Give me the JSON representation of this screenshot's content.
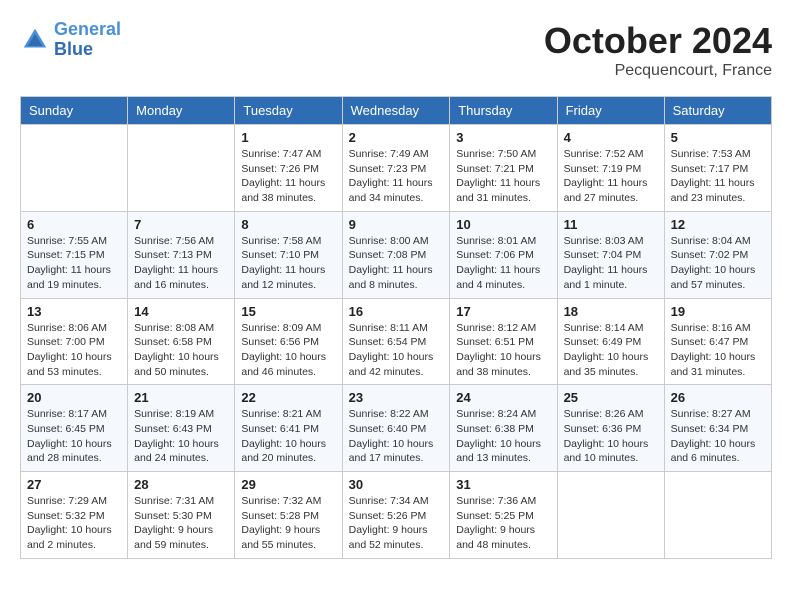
{
  "header": {
    "logo_line1": "General",
    "logo_line2": "Blue",
    "month": "October 2024",
    "location": "Pecquencourt, France"
  },
  "days_of_week": [
    "Sunday",
    "Monday",
    "Tuesday",
    "Wednesday",
    "Thursday",
    "Friday",
    "Saturday"
  ],
  "weeks": [
    [
      {
        "day": "",
        "info": ""
      },
      {
        "day": "",
        "info": ""
      },
      {
        "day": "1",
        "sunrise": "Sunrise: 7:47 AM",
        "sunset": "Sunset: 7:26 PM",
        "daylight": "Daylight: 11 hours and 38 minutes."
      },
      {
        "day": "2",
        "sunrise": "Sunrise: 7:49 AM",
        "sunset": "Sunset: 7:23 PM",
        "daylight": "Daylight: 11 hours and 34 minutes."
      },
      {
        "day": "3",
        "sunrise": "Sunrise: 7:50 AM",
        "sunset": "Sunset: 7:21 PM",
        "daylight": "Daylight: 11 hours and 31 minutes."
      },
      {
        "day": "4",
        "sunrise": "Sunrise: 7:52 AM",
        "sunset": "Sunset: 7:19 PM",
        "daylight": "Daylight: 11 hours and 27 minutes."
      },
      {
        "day": "5",
        "sunrise": "Sunrise: 7:53 AM",
        "sunset": "Sunset: 7:17 PM",
        "daylight": "Daylight: 11 hours and 23 minutes."
      }
    ],
    [
      {
        "day": "6",
        "sunrise": "Sunrise: 7:55 AM",
        "sunset": "Sunset: 7:15 PM",
        "daylight": "Daylight: 11 hours and 19 minutes."
      },
      {
        "day": "7",
        "sunrise": "Sunrise: 7:56 AM",
        "sunset": "Sunset: 7:13 PM",
        "daylight": "Daylight: 11 hours and 16 minutes."
      },
      {
        "day": "8",
        "sunrise": "Sunrise: 7:58 AM",
        "sunset": "Sunset: 7:10 PM",
        "daylight": "Daylight: 11 hours and 12 minutes."
      },
      {
        "day": "9",
        "sunrise": "Sunrise: 8:00 AM",
        "sunset": "Sunset: 7:08 PM",
        "daylight": "Daylight: 11 hours and 8 minutes."
      },
      {
        "day": "10",
        "sunrise": "Sunrise: 8:01 AM",
        "sunset": "Sunset: 7:06 PM",
        "daylight": "Daylight: 11 hours and 4 minutes."
      },
      {
        "day": "11",
        "sunrise": "Sunrise: 8:03 AM",
        "sunset": "Sunset: 7:04 PM",
        "daylight": "Daylight: 11 hours and 1 minute."
      },
      {
        "day": "12",
        "sunrise": "Sunrise: 8:04 AM",
        "sunset": "Sunset: 7:02 PM",
        "daylight": "Daylight: 10 hours and 57 minutes."
      }
    ],
    [
      {
        "day": "13",
        "sunrise": "Sunrise: 8:06 AM",
        "sunset": "Sunset: 7:00 PM",
        "daylight": "Daylight: 10 hours and 53 minutes."
      },
      {
        "day": "14",
        "sunrise": "Sunrise: 8:08 AM",
        "sunset": "Sunset: 6:58 PM",
        "daylight": "Daylight: 10 hours and 50 minutes."
      },
      {
        "day": "15",
        "sunrise": "Sunrise: 8:09 AM",
        "sunset": "Sunset: 6:56 PM",
        "daylight": "Daylight: 10 hours and 46 minutes."
      },
      {
        "day": "16",
        "sunrise": "Sunrise: 8:11 AM",
        "sunset": "Sunset: 6:54 PM",
        "daylight": "Daylight: 10 hours and 42 minutes."
      },
      {
        "day": "17",
        "sunrise": "Sunrise: 8:12 AM",
        "sunset": "Sunset: 6:51 PM",
        "daylight": "Daylight: 10 hours and 38 minutes."
      },
      {
        "day": "18",
        "sunrise": "Sunrise: 8:14 AM",
        "sunset": "Sunset: 6:49 PM",
        "daylight": "Daylight: 10 hours and 35 minutes."
      },
      {
        "day": "19",
        "sunrise": "Sunrise: 8:16 AM",
        "sunset": "Sunset: 6:47 PM",
        "daylight": "Daylight: 10 hours and 31 minutes."
      }
    ],
    [
      {
        "day": "20",
        "sunrise": "Sunrise: 8:17 AM",
        "sunset": "Sunset: 6:45 PM",
        "daylight": "Daylight: 10 hours and 28 minutes."
      },
      {
        "day": "21",
        "sunrise": "Sunrise: 8:19 AM",
        "sunset": "Sunset: 6:43 PM",
        "daylight": "Daylight: 10 hours and 24 minutes."
      },
      {
        "day": "22",
        "sunrise": "Sunrise: 8:21 AM",
        "sunset": "Sunset: 6:41 PM",
        "daylight": "Daylight: 10 hours and 20 minutes."
      },
      {
        "day": "23",
        "sunrise": "Sunrise: 8:22 AM",
        "sunset": "Sunset: 6:40 PM",
        "daylight": "Daylight: 10 hours and 17 minutes."
      },
      {
        "day": "24",
        "sunrise": "Sunrise: 8:24 AM",
        "sunset": "Sunset: 6:38 PM",
        "daylight": "Daylight: 10 hours and 13 minutes."
      },
      {
        "day": "25",
        "sunrise": "Sunrise: 8:26 AM",
        "sunset": "Sunset: 6:36 PM",
        "daylight": "Daylight: 10 hours and 10 minutes."
      },
      {
        "day": "26",
        "sunrise": "Sunrise: 8:27 AM",
        "sunset": "Sunset: 6:34 PM",
        "daylight": "Daylight: 10 hours and 6 minutes."
      }
    ],
    [
      {
        "day": "27",
        "sunrise": "Sunrise: 7:29 AM",
        "sunset": "Sunset: 5:32 PM",
        "daylight": "Daylight: 10 hours and 2 minutes."
      },
      {
        "day": "28",
        "sunrise": "Sunrise: 7:31 AM",
        "sunset": "Sunset: 5:30 PM",
        "daylight": "Daylight: 9 hours and 59 minutes."
      },
      {
        "day": "29",
        "sunrise": "Sunrise: 7:32 AM",
        "sunset": "Sunset: 5:28 PM",
        "daylight": "Daylight: 9 hours and 55 minutes."
      },
      {
        "day": "30",
        "sunrise": "Sunrise: 7:34 AM",
        "sunset": "Sunset: 5:26 PM",
        "daylight": "Daylight: 9 hours and 52 minutes."
      },
      {
        "day": "31",
        "sunrise": "Sunrise: 7:36 AM",
        "sunset": "Sunset: 5:25 PM",
        "daylight": "Daylight: 9 hours and 48 minutes."
      },
      {
        "day": "",
        "info": ""
      },
      {
        "day": "",
        "info": ""
      }
    ]
  ]
}
